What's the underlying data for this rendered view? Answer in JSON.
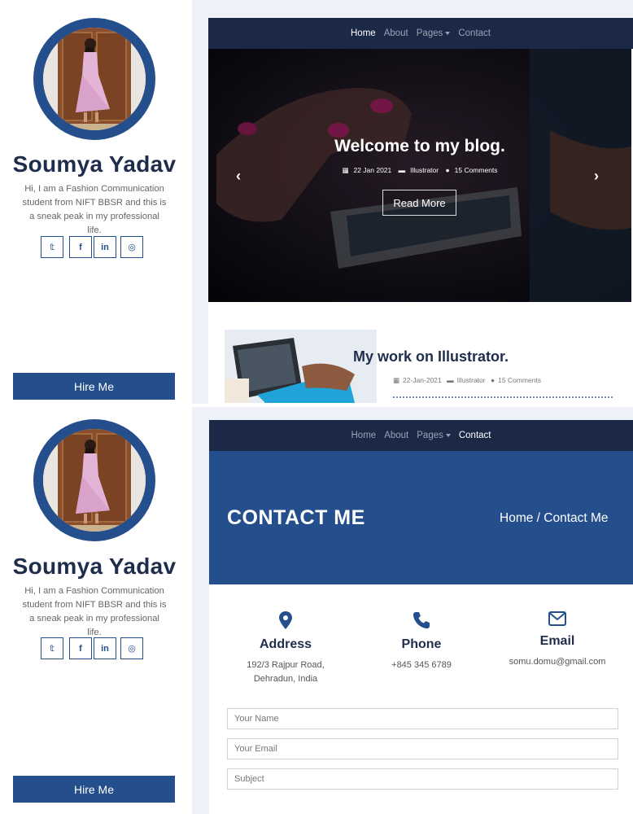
{
  "profile": {
    "name": "Soumya Yadav",
    "bio": "Hi, I am a Fashion Communication student from NIFT BBSR and this is a sneak peak in my professional life.",
    "socials": [
      "twitter-icon",
      "facebook-icon",
      "linkedin-icon",
      "instagram-icon"
    ],
    "social_glyphs": [
      "𝕥",
      "f",
      "in",
      "◎"
    ],
    "hire_label": "Hire Me"
  },
  "nav": {
    "items": [
      {
        "label": "Home"
      },
      {
        "label": "About"
      },
      {
        "label": "Pages"
      },
      {
        "label": "Contact"
      }
    ]
  },
  "hero": {
    "title": "Welcome to my blog.",
    "date": "22 Jan 2021",
    "category": "Illustrator",
    "comments": "15 Comments",
    "read_more": "Read More",
    "prev_arrow": "‹",
    "next_arrow": "›"
  },
  "post": {
    "title": "My work on Illustrator.",
    "date": "22-Jan-2021",
    "category": "Illustrator",
    "comments": "15 Comments"
  },
  "contact": {
    "title": "CONTACT ME",
    "breadcrumb": "Home / Contact Me",
    "address": {
      "label": "Address",
      "line1": "192/3 Rajpur Road,",
      "line2": "Dehradun, India"
    },
    "phone": {
      "label": "Phone",
      "value": "+845 345 6789"
    },
    "email": {
      "label": "Email",
      "value": "somu.domu@gmail.com"
    },
    "form": {
      "name_placeholder": "Your Name",
      "email_placeholder": "Your Email",
      "subject_placeholder": "Subject"
    }
  },
  "colors": {
    "primary": "#244f8c",
    "navbar": "#1b2946",
    "heading": "#1f2d4d",
    "background": "#eef1f8"
  }
}
